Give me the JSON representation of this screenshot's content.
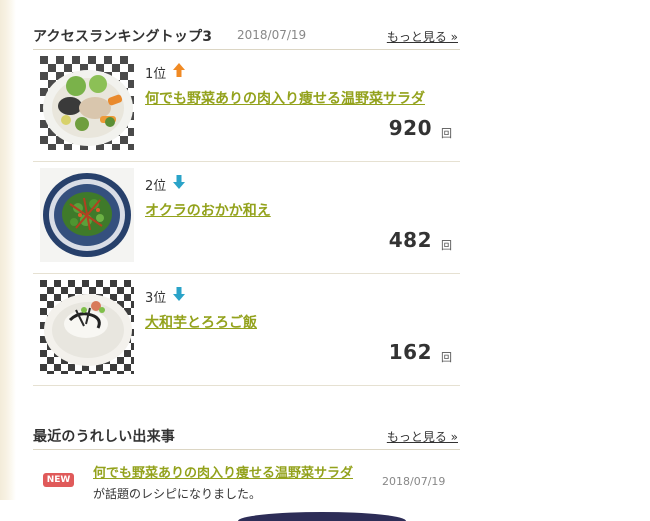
{
  "ranking": {
    "title": "アクセスランキングトップ3",
    "date": "2018/07/19",
    "more_label": "もっと見る »",
    "count_unit": "回",
    "items": [
      {
        "rank_label": "1位",
        "trend": "up",
        "trend_icon": "arrow-up-icon",
        "trend_color": "#f08a24",
        "title": "何でも野菜ありの肉入り痩せる温野菜サラダ",
        "count": "920"
      },
      {
        "rank_label": "2位",
        "trend": "down",
        "trend_icon": "arrow-down-icon",
        "trend_color": "#2aa3c8",
        "title": "オクラのおかか和え",
        "count": "482"
      },
      {
        "rank_label": "3位",
        "trend": "down",
        "trend_icon": "arrow-down-icon",
        "trend_color": "#2aa3c8",
        "title": "大和芋とろろご飯",
        "count": "162"
      }
    ]
  },
  "news": {
    "title": "最近のうれしい出来事",
    "more_label": "もっと見る »",
    "items": [
      {
        "badge": "NEW",
        "link": "何でも野菜ありの肉入り痩せる温野菜サラダ",
        "text": "が話題のレシピになりました。",
        "date": "2018/07/19"
      }
    ]
  },
  "colors": {
    "link_green": "#93a21c",
    "badge_red": "#e05a5a",
    "up_orange": "#f08a24",
    "down_blue": "#2aa3c8"
  }
}
